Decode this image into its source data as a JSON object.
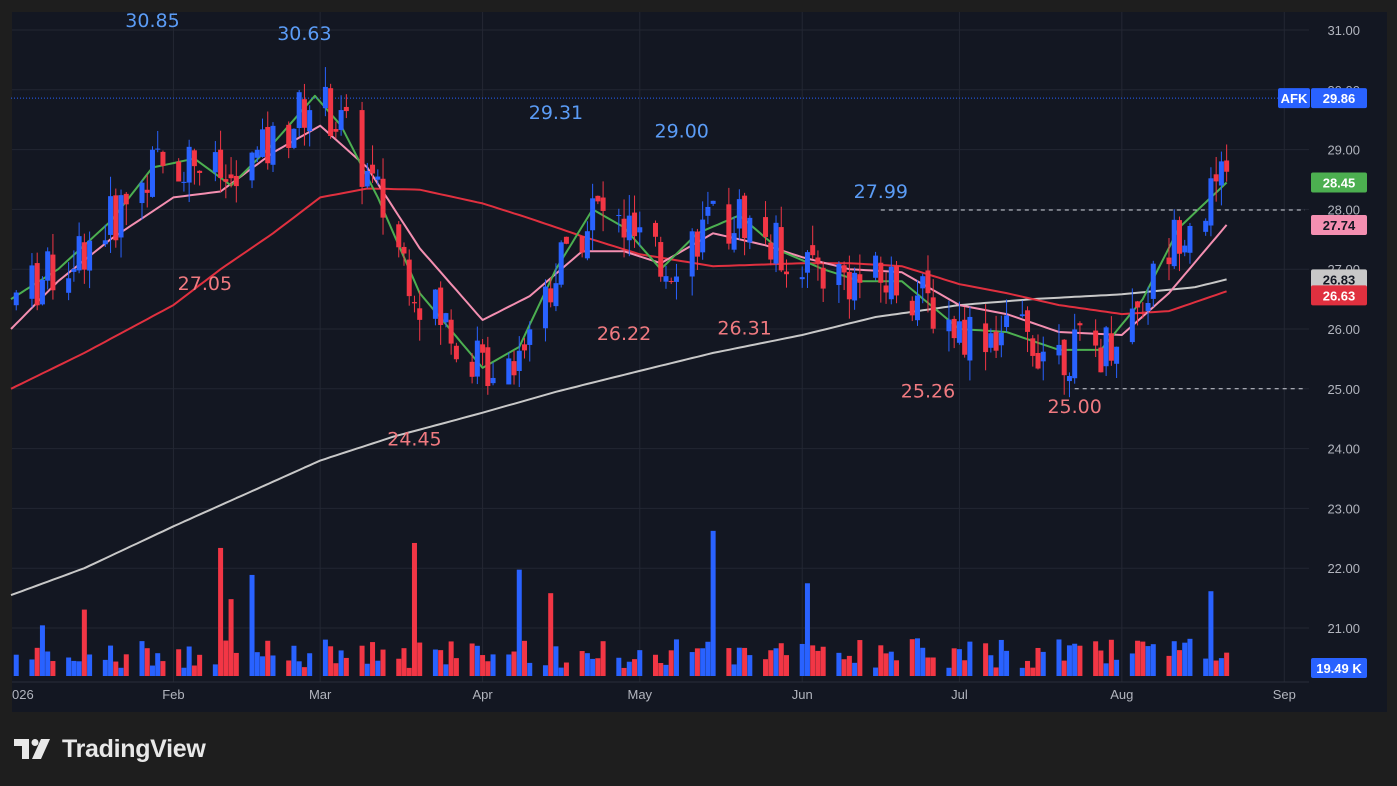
{
  "app": {
    "brand_name": "TradingView",
    "symbol": "AFK"
  },
  "colors": {
    "background": "#131722",
    "frame": "#1e1e1e",
    "up": "#2962ff",
    "down": "#f23645",
    "sma_fast": "#4caf50",
    "ema_pink": "#f48fb1",
    "sma_50": "#e0303f",
    "sma_200": "#c8c8c8",
    "price_tag": "#2962ff",
    "up_label": "#5b9cf6",
    "down_label": "#f07a80"
  },
  "chart_data": {
    "type": "candlestick",
    "symbol": "AFK",
    "x_axis": {
      "start": "2026-01-01",
      "end": "2026-09-04",
      "tick_labels": [
        {
          "label": "026",
          "date": "2026-01-01"
        },
        {
          "label": "Feb",
          "date": "2026-02-01"
        },
        {
          "label": "Mar",
          "date": "2026-03-01"
        },
        {
          "label": "Apr",
          "date": "2026-04-01"
        },
        {
          "label": "May",
          "date": "2026-05-01"
        },
        {
          "label": "Jun",
          "date": "2026-06-01"
        },
        {
          "label": "Jul",
          "date": "2026-07-01"
        },
        {
          "label": "Aug",
          "date": "2026-08-01"
        },
        {
          "label": "Sep",
          "date": "2026-09-01"
        }
      ]
    },
    "y_axis": {
      "min": 20.3,
      "max": 31.3,
      "tick_labels": [
        "31.00",
        "30.00",
        "29.00",
        "28.00",
        "27.00",
        "26.00",
        "25.00",
        "24.00",
        "23.00",
        "22.00",
        "21.00"
      ],
      "tick_values": [
        31,
        30,
        29,
        28,
        27,
        26,
        25,
        24,
        23,
        22,
        21
      ]
    },
    "grid": true,
    "last_price": 29.86,
    "price_tags": [
      {
        "label": "AFK",
        "value": 29.86,
        "color": "#2962ff",
        "is_symbol": true
      },
      {
        "label": "29.86",
        "value": 29.86,
        "color": "#2962ff"
      },
      {
        "label": "28.45",
        "value": 28.45,
        "color": "#4caf50"
      },
      {
        "label": "27.74",
        "value": 27.74,
        "color": "#f48fb1"
      },
      {
        "label": "26.83",
        "value": 26.83,
        "color": "#c8c8c8"
      },
      {
        "label": "26.63",
        "value": 26.63,
        "color": "#e0303f"
      },
      {
        "label": "19.49 K",
        "value": 19.49,
        "color": "#2962ff",
        "is_volume": true
      }
    ],
    "annotations": [
      {
        "text": "30.85",
        "date": "2026-01-28",
        "value": 30.85,
        "kind": "high"
      },
      {
        "text": "30.63",
        "date": "2026-02-26",
        "value": 30.63,
        "kind": "high"
      },
      {
        "text": "27.05",
        "date": "2026-02-07",
        "value": 27.05,
        "kind": "low"
      },
      {
        "text": "29.31",
        "date": "2026-04-15",
        "value": 29.31,
        "kind": "high"
      },
      {
        "text": "29.00",
        "date": "2026-05-09",
        "value": 29.0,
        "kind": "high"
      },
      {
        "text": "24.45",
        "date": "2026-03-19",
        "value": 24.45,
        "kind": "low"
      },
      {
        "text": "26.22",
        "date": "2026-04-28",
        "value": 26.22,
        "kind": "low"
      },
      {
        "text": "26.31",
        "date": "2026-05-21",
        "value": 26.31,
        "kind": "low"
      },
      {
        "text": "27.99",
        "date": "2026-06-16",
        "value": 27.99,
        "kind": "high"
      },
      {
        "text": "25.26",
        "date": "2026-06-25",
        "value": 25.26,
        "kind": "low"
      },
      {
        "text": "25.00",
        "date": "2026-07-23",
        "value": 25.0,
        "kind": "low"
      }
    ],
    "reference_lines": [
      {
        "value": 27.99,
        "from": "2026-06-16",
        "dashed": true
      },
      {
        "value": 25.0,
        "from": "2026-07-23",
        "dashed": true
      },
      {
        "value": 29.86,
        "from": "2026-01-01",
        "dotted": true
      }
    ],
    "series": [
      {
        "kind": "moving_average",
        "color": "#c8c8c8",
        "points": [
          [
            "2026-01-01",
            21.55
          ],
          [
            "2026-01-15",
            22.0
          ],
          [
            "2026-02-01",
            22.7
          ],
          [
            "2026-02-15",
            23.25
          ],
          [
            "2026-03-01",
            23.8
          ],
          [
            "2026-03-15",
            24.2
          ],
          [
            "2026-04-01",
            24.6
          ],
          [
            "2026-04-15",
            24.95
          ],
          [
            "2026-05-01",
            25.3
          ],
          [
            "2026-05-15",
            25.6
          ],
          [
            "2026-06-01",
            25.9
          ],
          [
            "2026-06-15",
            26.2
          ],
          [
            "2026-07-01",
            26.4
          ],
          [
            "2026-07-15",
            26.5
          ],
          [
            "2026-08-01",
            26.58
          ],
          [
            "2026-08-15",
            26.7
          ],
          [
            "2026-08-21",
            26.83
          ]
        ]
      },
      {
        "kind": "moving_average",
        "color": "#e0303f",
        "points": [
          [
            "2026-01-01",
            25.0
          ],
          [
            "2026-01-15",
            25.6
          ],
          [
            "2026-02-01",
            26.4
          ],
          [
            "2026-02-10",
            27.0
          ],
          [
            "2026-02-20",
            27.6
          ],
          [
            "2026-03-01",
            28.2
          ],
          [
            "2026-03-10",
            28.35
          ],
          [
            "2026-03-20",
            28.33
          ],
          [
            "2026-04-01",
            28.1
          ],
          [
            "2026-04-10",
            27.85
          ],
          [
            "2026-04-20",
            27.55
          ],
          [
            "2026-05-01",
            27.25
          ],
          [
            "2026-05-15",
            27.05
          ],
          [
            "2026-06-01",
            27.1
          ],
          [
            "2026-06-10",
            27.1
          ],
          [
            "2026-06-20",
            27.05
          ],
          [
            "2026-07-01",
            26.75
          ],
          [
            "2026-07-10",
            26.6
          ],
          [
            "2026-07-20",
            26.4
          ],
          [
            "2026-08-01",
            26.25
          ],
          [
            "2026-08-10",
            26.3
          ],
          [
            "2026-08-21",
            26.63
          ]
        ]
      },
      {
        "kind": "moving_average",
        "color": "#f48fb1",
        "points": [
          [
            "2026-01-01",
            26.0
          ],
          [
            "2026-01-10",
            26.8
          ],
          [
            "2026-01-20",
            27.5
          ],
          [
            "2026-02-01",
            28.2
          ],
          [
            "2026-02-10",
            28.3
          ],
          [
            "2026-02-20",
            28.95
          ],
          [
            "2026-03-01",
            29.4
          ],
          [
            "2026-03-10",
            28.7
          ],
          [
            "2026-03-20",
            27.35
          ],
          [
            "2026-04-01",
            26.15
          ],
          [
            "2026-04-10",
            26.55
          ],
          [
            "2026-04-20",
            27.3
          ],
          [
            "2026-04-28",
            27.3
          ],
          [
            "2026-05-05",
            27.1
          ],
          [
            "2026-05-15",
            27.6
          ],
          [
            "2026-05-25",
            27.4
          ],
          [
            "2026-06-01",
            27.2
          ],
          [
            "2026-06-10",
            27.0
          ],
          [
            "2026-06-20",
            26.95
          ],
          [
            "2026-07-01",
            26.4
          ],
          [
            "2026-07-10",
            26.25
          ],
          [
            "2026-07-20",
            25.95
          ],
          [
            "2026-08-01",
            25.9
          ],
          [
            "2026-08-10",
            26.6
          ],
          [
            "2026-08-21",
            27.74
          ]
        ]
      },
      {
        "kind": "moving_average",
        "color": "#4caf50",
        "points": [
          [
            "2026-01-01",
            26.5
          ],
          [
            "2026-01-10",
            27.0
          ],
          [
            "2026-01-20",
            27.8
          ],
          [
            "2026-01-28",
            28.7
          ],
          [
            "2026-02-05",
            28.85
          ],
          [
            "2026-02-12",
            28.4
          ],
          [
            "2026-02-20",
            29.1
          ],
          [
            "2026-02-28",
            29.9
          ],
          [
            "2026-03-05",
            29.4
          ],
          [
            "2026-03-12",
            28.2
          ],
          [
            "2026-03-20",
            26.6
          ],
          [
            "2026-04-01",
            25.35
          ],
          [
            "2026-04-08",
            25.7
          ],
          [
            "2026-04-15",
            27.0
          ],
          [
            "2026-04-22",
            28.0
          ],
          [
            "2026-04-28",
            27.7
          ],
          [
            "2026-05-05",
            27.0
          ],
          [
            "2026-05-12",
            27.6
          ],
          [
            "2026-05-20",
            27.9
          ],
          [
            "2026-05-28",
            27.3
          ],
          [
            "2026-06-05",
            27.0
          ],
          [
            "2026-06-12",
            26.8
          ],
          [
            "2026-06-20",
            26.8
          ],
          [
            "2026-07-01",
            26.0
          ],
          [
            "2026-07-10",
            25.95
          ],
          [
            "2026-07-20",
            25.65
          ],
          [
            "2026-07-28",
            25.65
          ],
          [
            "2026-08-05",
            26.5
          ],
          [
            "2026-08-12",
            27.7
          ],
          [
            "2026-08-21",
            28.45
          ]
        ]
      }
    ]
  }
}
